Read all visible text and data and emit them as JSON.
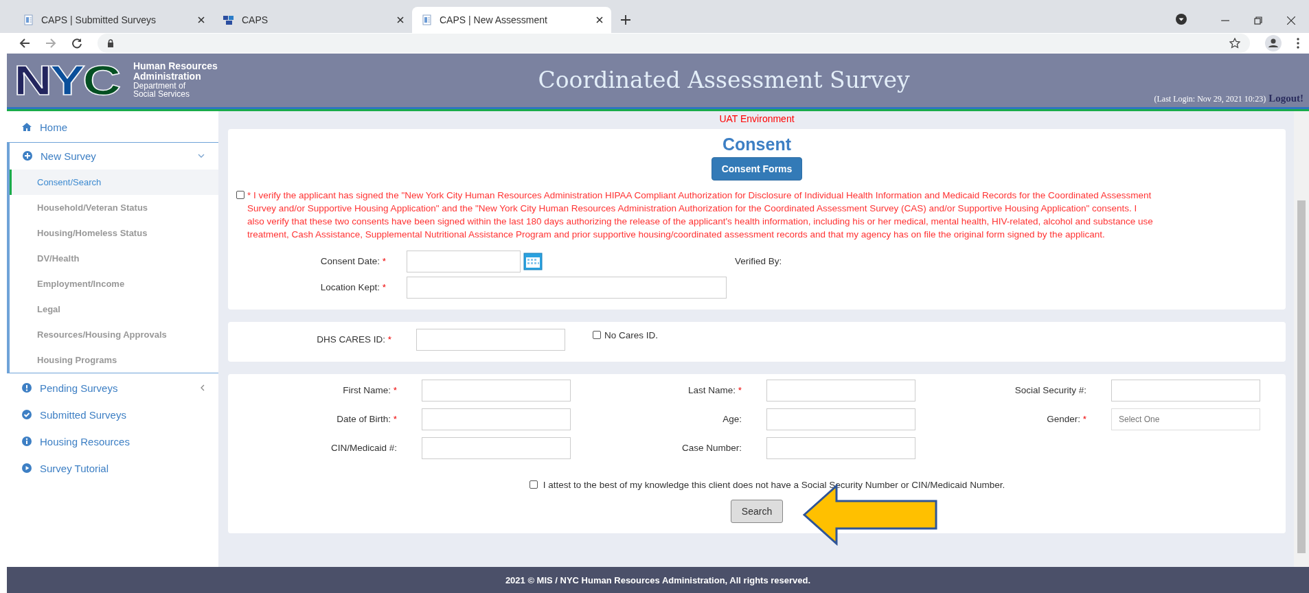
{
  "browser": {
    "tabs": [
      {
        "title": "CAPS | Submitted Surveys",
        "selected": false
      },
      {
        "title": "CAPS",
        "selected": false
      },
      {
        "title": "CAPS | New Assessment",
        "selected": true
      }
    ]
  },
  "header": {
    "logo": "NYC",
    "org_name": [
      "Human Resources",
      "Administration"
    ],
    "org_dept": [
      "Department of",
      "Social Services"
    ],
    "title": "Coordinated Assessment Survey",
    "last_login": "(Last Login: Nov 29, 2021 10:23)",
    "logout": "Logout!"
  },
  "environment": "UAT Environment",
  "sidebar": {
    "items": [
      {
        "label": "Home",
        "selected": false
      },
      {
        "label": "New Survey",
        "selected": false,
        "expanded": true,
        "children": [
          {
            "label": "Consent/Search",
            "selected": true
          },
          {
            "label": "Household/Veteran Status",
            "selected": false
          },
          {
            "label": "Housing/Homeless Status",
            "selected": false
          },
          {
            "label": "DV/Health",
            "selected": false
          },
          {
            "label": "Employment/Income",
            "selected": false
          },
          {
            "label": "Legal",
            "selected": false
          },
          {
            "label": "Resources/Housing Approvals",
            "selected": false
          },
          {
            "label": "Housing Programs",
            "selected": false
          }
        ]
      },
      {
        "label": "Pending Surveys",
        "selected": false,
        "expanded": false
      },
      {
        "label": "Submitted Surveys",
        "selected": false
      },
      {
        "label": "Housing Resources",
        "selected": false
      },
      {
        "label": "Survey Tutorial",
        "selected": false
      }
    ]
  },
  "consent": {
    "title": "Consent",
    "button": "Consent Forms",
    "statement": {
      "checked": false,
      "text": "* I verify the applicant has signed the \"New York City Human Resources Administration HIPAA Compliant Authorization for Disclosure of Individual Health Information and Medicaid Records for the Coordinated Assessment Survey and/or Supportive Housing Application\" and the \"New York City Human Resources Administration Authorization for the Coordinated Assessment Survey (CAS) and/or Supportive Housing Application\" consents. I also verify that these two consents have been signed within the last 180 days authorizing the release of the applicant's health information, including his or her medical, mental health, HIV-related, alcohol and substance use treatment, Cash Assistance, Supplemental Nutritional Assistance Program and prior supportive housing/coordinated assessment records and that my agency has on file the original form signed by the applicant."
    },
    "consent_date": {
      "label": "Consent Date:",
      "required_mark": "*"
    },
    "verified_by": {
      "label": "Verified By:"
    },
    "location_kept": {
      "label": "Location Kept:",
      "required_mark": "*"
    }
  },
  "cares": {
    "field": {
      "label": "DHS CARES ID:",
      "required_mark": "*"
    },
    "no_cares": {
      "label": "No Cares ID.",
      "checked": false
    }
  },
  "client": {
    "fields": [
      {
        "label": "First Name:",
        "required_mark": "*"
      },
      {
        "label": "Last Name:",
        "required_mark": "*"
      },
      {
        "label": "Social Security #:"
      },
      {
        "label": "Date of Birth:",
        "required_mark": "*"
      },
      {
        "label": "Age:"
      },
      {
        "label": "Gender:",
        "required_mark": "*",
        "kind": "select",
        "placeholder": "Select One"
      },
      {
        "label": "CIN/Medicaid #:"
      },
      {
        "label": "Case Number:"
      }
    ],
    "attest": {
      "label": "I attest to the best of my knowledge this client does not have a Social Security Number or CIN/Medicaid Number.",
      "checked": false
    },
    "button": "Search"
  },
  "footer": "2021 © MIS / NYC Human Resources Administration, All rights reserved."
}
